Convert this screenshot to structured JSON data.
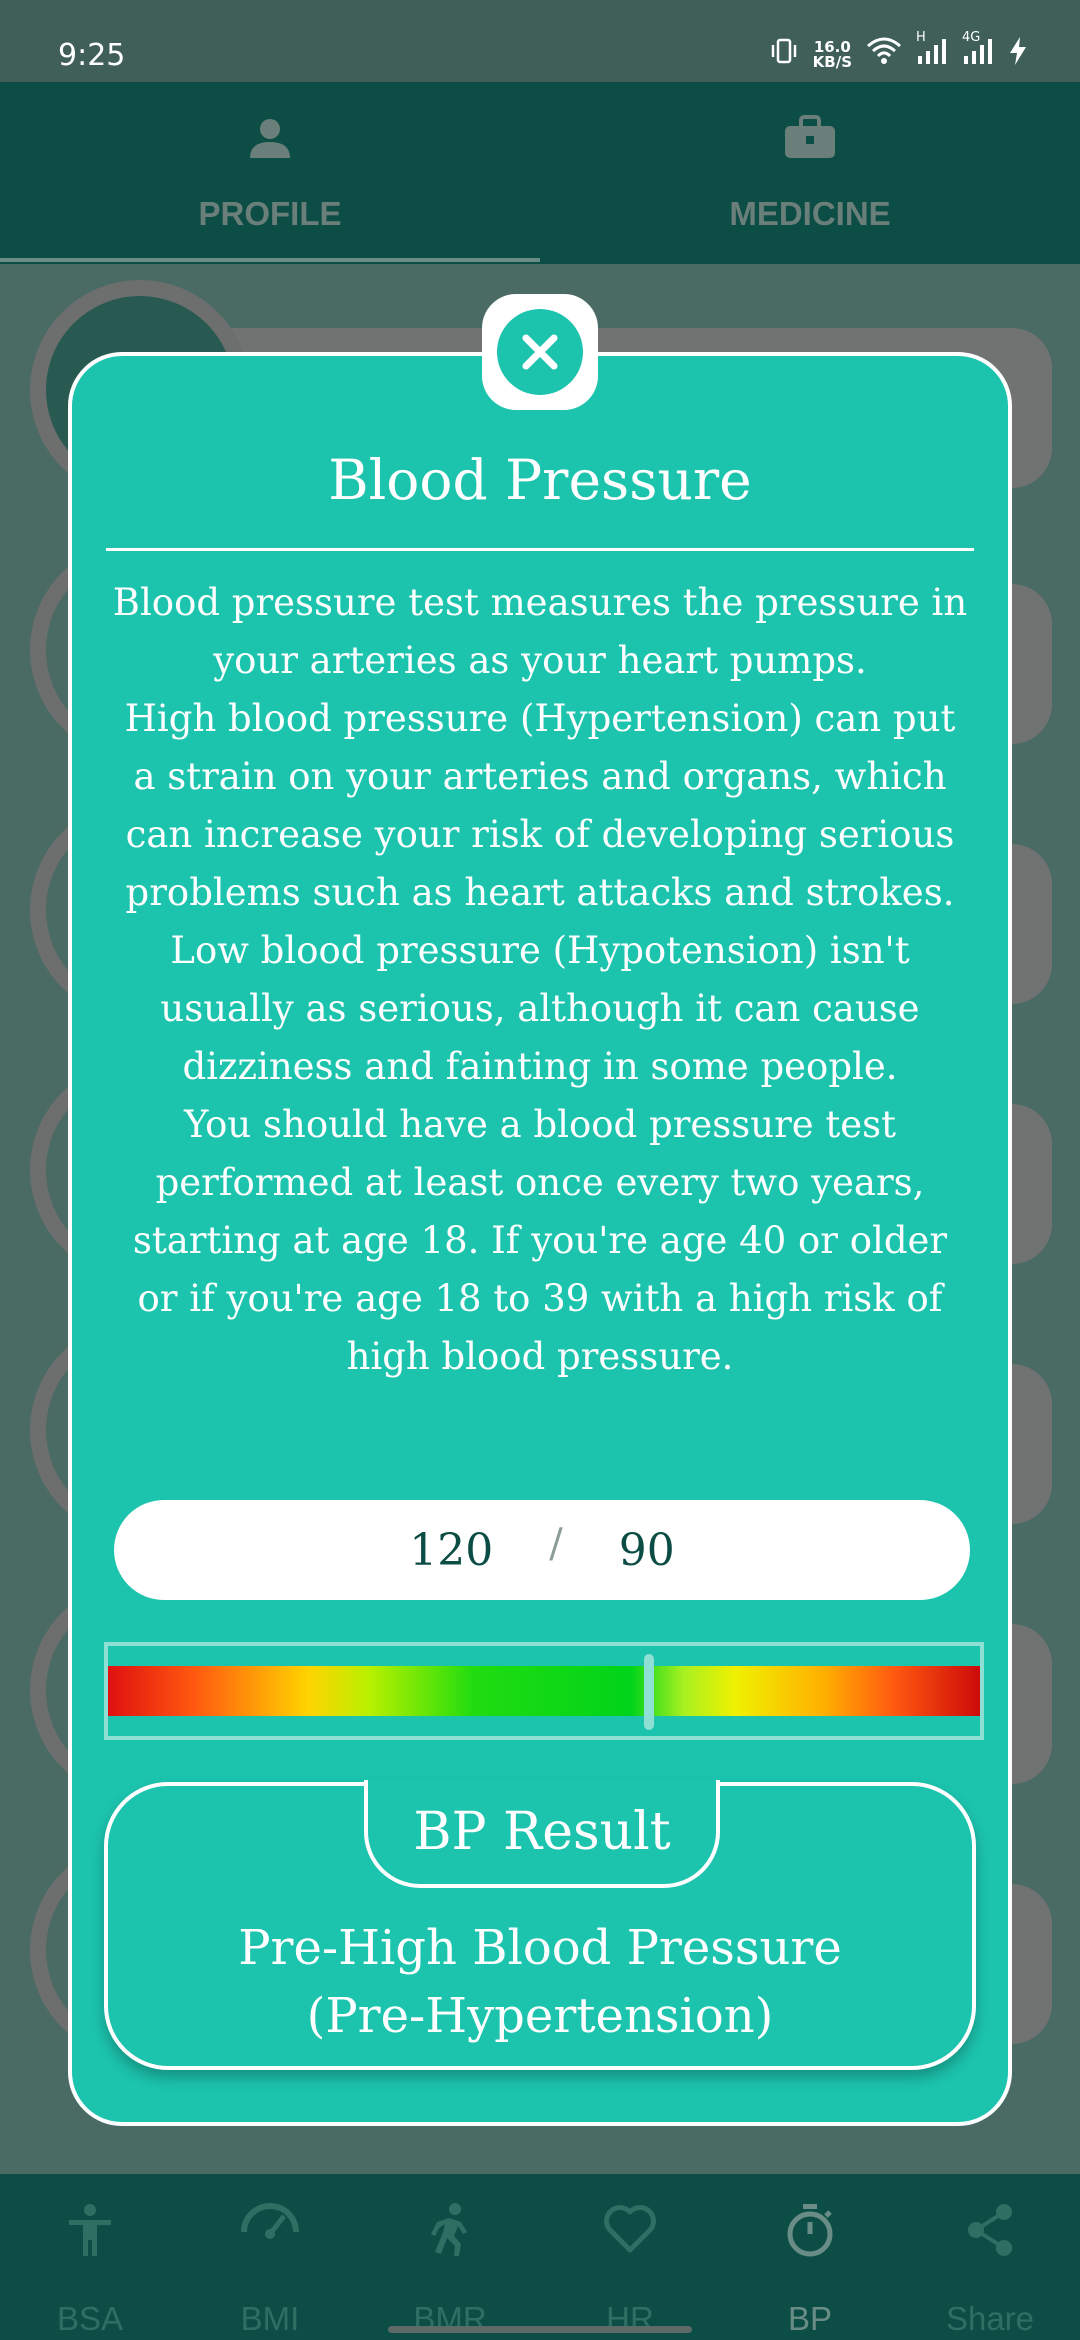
{
  "status_bar": {
    "time": "9:25",
    "network_speed_value": "16.0",
    "network_speed_unit": "KB/S",
    "signal_label_1": "H",
    "signal_label_2": "4G"
  },
  "top_tabs": [
    {
      "label": "PROFILE",
      "icon": "person-icon",
      "selected": true
    },
    {
      "label": "MEDICINE",
      "icon": "briefcase-icon",
      "selected": false
    }
  ],
  "dialog": {
    "title": "Blood Pressure",
    "description": "Blood pressure test measures the pressure in your arteries as your heart pumps.\n High blood pressure (Hypertension) can put a strain on your arteries and organs, which can increase your risk of developing serious problems such as heart attacks and strokes.\n Low blood pressure (Hypotension) isn't usually as serious, although it can cause dizziness and fainting in some people.\n You should have a blood pressure test performed at least once every two years, starting at age 18. If you're age 40 or older or if you're age 18 to 39 with a high risk of high blood pressure.",
    "systolic": "120",
    "separator": "/",
    "diastolic": "90",
    "scale_marker_fraction": 0.62,
    "result_heading": "BP Result",
    "result_line1": "Pre-High Blood Pressure",
    "result_line2": "(Pre-Hypertension)"
  },
  "bottom_nav": [
    {
      "label": "BSA",
      "icon": "person-standing-icon",
      "active": false
    },
    {
      "label": "BMI",
      "icon": "gauge-icon",
      "active": false
    },
    {
      "label": "BMR",
      "icon": "runner-icon",
      "active": false
    },
    {
      "label": "HR",
      "icon": "heart-icon",
      "active": false
    },
    {
      "label": "BP",
      "icon": "stopwatch-icon",
      "active": true
    },
    {
      "label": "Share",
      "icon": "share-icon",
      "active": false
    }
  ],
  "colors": {
    "accent": "#1cc4ae",
    "header": "#0c4e45",
    "value_text": "#0b4d44"
  }
}
